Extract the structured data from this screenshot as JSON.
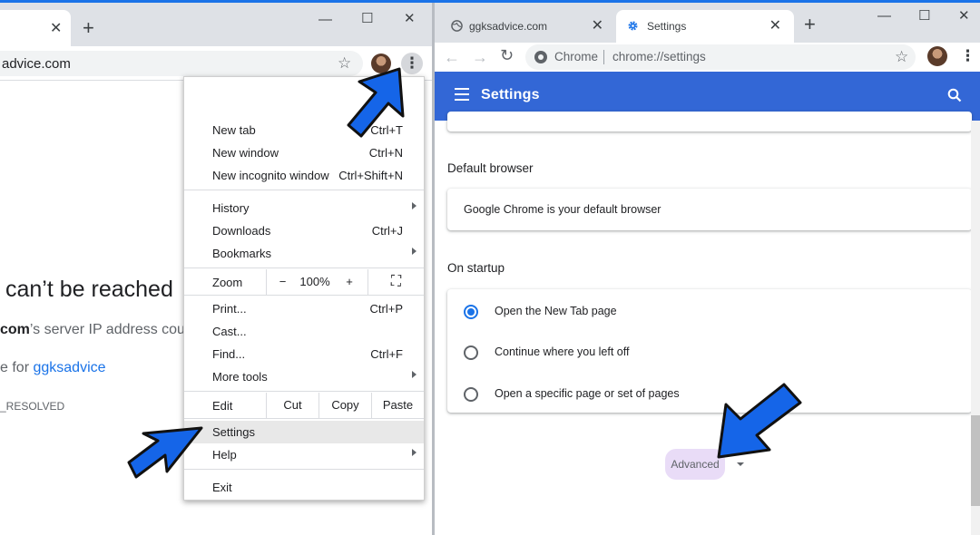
{
  "left_window": {
    "tab_close": "✕",
    "new_tab": "+",
    "window_controls": {
      "minimize": "—",
      "maximize": "☐",
      "close": "✕"
    },
    "url": "advice.com",
    "star": "☆",
    "menu_dots": "⋮",
    "error": {
      "title": "can’t be reached",
      "line1_bold": "com",
      "line1_rest": "’s server IP address could n",
      "line2_prefix": "e for ",
      "line2_link": "ggksadvice",
      "code": "_RESOLVED"
    }
  },
  "chrome_menu": {
    "new_tab": {
      "label": "New tab",
      "shortcut": "Ctrl+T"
    },
    "new_window": {
      "label": "New window",
      "shortcut": "Ctrl+N"
    },
    "new_incognito": {
      "label": "New incognito window",
      "shortcut": "Ctrl+Shift+N"
    },
    "history": {
      "label": "History"
    },
    "downloads": {
      "label": "Downloads",
      "shortcut": "Ctrl+J"
    },
    "bookmarks": {
      "label": "Bookmarks"
    },
    "zoom": {
      "label": "Zoom",
      "minus": "−",
      "value": "100%",
      "plus": "+",
      "fullscreen": "⛶"
    },
    "print": {
      "label": "Print...",
      "shortcut": "Ctrl+P"
    },
    "cast": {
      "label": "Cast..."
    },
    "find": {
      "label": "Find...",
      "shortcut": "Ctrl+F"
    },
    "more_tools": {
      "label": "More tools"
    },
    "edit": {
      "label": "Edit",
      "cut": "Cut",
      "copy": "Copy",
      "paste": "Paste"
    },
    "settings": {
      "label": "Settings"
    },
    "help": {
      "label": "Help"
    },
    "exit": {
      "label": "Exit"
    }
  },
  "right_window": {
    "tabs": [
      {
        "label": "ggksadvice.com",
        "close": "✕",
        "icon": "globe-icon"
      },
      {
        "label": "Settings",
        "close": "✕",
        "icon": "gear-icon"
      }
    ],
    "new_tab": "+",
    "window_controls": {
      "minimize": "—",
      "maximize": "☐",
      "close": "✕"
    },
    "nav": {
      "back": "←",
      "forward": "→",
      "reload": "↻"
    },
    "omnibox": {
      "site": "Chrome",
      "url": "chrome://settings"
    },
    "star": "☆",
    "menu_dots": "⋮",
    "header": {
      "title": "Settings"
    },
    "default_browser": {
      "heading": "Default browser",
      "status": "Google Chrome is your default browser"
    },
    "on_startup": {
      "heading": "On startup",
      "options": [
        {
          "label": "Open the New Tab page",
          "selected": true
        },
        {
          "label": "Continue where you left off",
          "selected": false
        },
        {
          "label": "Open a specific page or set of pages",
          "selected": false
        }
      ]
    },
    "advanced": {
      "label": "Advanced"
    }
  },
  "colors": {
    "chrome_blue": "#3367d6",
    "accent": "#1a73e8",
    "tabstrip": "#dee1e6",
    "arrow_fill": "#1565e8",
    "advanced_highlight": "#e9dcf7"
  }
}
